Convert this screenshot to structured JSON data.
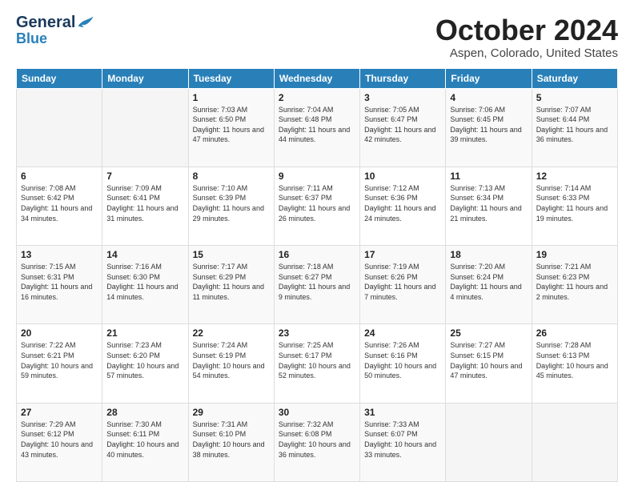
{
  "header": {
    "logo_general": "General",
    "logo_blue": "Blue",
    "title": "October 2024",
    "location": "Aspen, Colorado, United States"
  },
  "weekdays": [
    "Sunday",
    "Monday",
    "Tuesday",
    "Wednesday",
    "Thursday",
    "Friday",
    "Saturday"
  ],
  "weeks": [
    [
      {
        "day": "",
        "info": ""
      },
      {
        "day": "",
        "info": ""
      },
      {
        "day": "1",
        "info": "Sunrise: 7:03 AM\nSunset: 6:50 PM\nDaylight: 11 hours and 47 minutes."
      },
      {
        "day": "2",
        "info": "Sunrise: 7:04 AM\nSunset: 6:48 PM\nDaylight: 11 hours and 44 minutes."
      },
      {
        "day": "3",
        "info": "Sunrise: 7:05 AM\nSunset: 6:47 PM\nDaylight: 11 hours and 42 minutes."
      },
      {
        "day": "4",
        "info": "Sunrise: 7:06 AM\nSunset: 6:45 PM\nDaylight: 11 hours and 39 minutes."
      },
      {
        "day": "5",
        "info": "Sunrise: 7:07 AM\nSunset: 6:44 PM\nDaylight: 11 hours and 36 minutes."
      }
    ],
    [
      {
        "day": "6",
        "info": "Sunrise: 7:08 AM\nSunset: 6:42 PM\nDaylight: 11 hours and 34 minutes."
      },
      {
        "day": "7",
        "info": "Sunrise: 7:09 AM\nSunset: 6:41 PM\nDaylight: 11 hours and 31 minutes."
      },
      {
        "day": "8",
        "info": "Sunrise: 7:10 AM\nSunset: 6:39 PM\nDaylight: 11 hours and 29 minutes."
      },
      {
        "day": "9",
        "info": "Sunrise: 7:11 AM\nSunset: 6:37 PM\nDaylight: 11 hours and 26 minutes."
      },
      {
        "day": "10",
        "info": "Sunrise: 7:12 AM\nSunset: 6:36 PM\nDaylight: 11 hours and 24 minutes."
      },
      {
        "day": "11",
        "info": "Sunrise: 7:13 AM\nSunset: 6:34 PM\nDaylight: 11 hours and 21 minutes."
      },
      {
        "day": "12",
        "info": "Sunrise: 7:14 AM\nSunset: 6:33 PM\nDaylight: 11 hours and 19 minutes."
      }
    ],
    [
      {
        "day": "13",
        "info": "Sunrise: 7:15 AM\nSunset: 6:31 PM\nDaylight: 11 hours and 16 minutes."
      },
      {
        "day": "14",
        "info": "Sunrise: 7:16 AM\nSunset: 6:30 PM\nDaylight: 11 hours and 14 minutes."
      },
      {
        "day": "15",
        "info": "Sunrise: 7:17 AM\nSunset: 6:29 PM\nDaylight: 11 hours and 11 minutes."
      },
      {
        "day": "16",
        "info": "Sunrise: 7:18 AM\nSunset: 6:27 PM\nDaylight: 11 hours and 9 minutes."
      },
      {
        "day": "17",
        "info": "Sunrise: 7:19 AM\nSunset: 6:26 PM\nDaylight: 11 hours and 7 minutes."
      },
      {
        "day": "18",
        "info": "Sunrise: 7:20 AM\nSunset: 6:24 PM\nDaylight: 11 hours and 4 minutes."
      },
      {
        "day": "19",
        "info": "Sunrise: 7:21 AM\nSunset: 6:23 PM\nDaylight: 11 hours and 2 minutes."
      }
    ],
    [
      {
        "day": "20",
        "info": "Sunrise: 7:22 AM\nSunset: 6:21 PM\nDaylight: 10 hours and 59 minutes."
      },
      {
        "day": "21",
        "info": "Sunrise: 7:23 AM\nSunset: 6:20 PM\nDaylight: 10 hours and 57 minutes."
      },
      {
        "day": "22",
        "info": "Sunrise: 7:24 AM\nSunset: 6:19 PM\nDaylight: 10 hours and 54 minutes."
      },
      {
        "day": "23",
        "info": "Sunrise: 7:25 AM\nSunset: 6:17 PM\nDaylight: 10 hours and 52 minutes."
      },
      {
        "day": "24",
        "info": "Sunrise: 7:26 AM\nSunset: 6:16 PM\nDaylight: 10 hours and 50 minutes."
      },
      {
        "day": "25",
        "info": "Sunrise: 7:27 AM\nSunset: 6:15 PM\nDaylight: 10 hours and 47 minutes."
      },
      {
        "day": "26",
        "info": "Sunrise: 7:28 AM\nSunset: 6:13 PM\nDaylight: 10 hours and 45 minutes."
      }
    ],
    [
      {
        "day": "27",
        "info": "Sunrise: 7:29 AM\nSunset: 6:12 PM\nDaylight: 10 hours and 43 minutes."
      },
      {
        "day": "28",
        "info": "Sunrise: 7:30 AM\nSunset: 6:11 PM\nDaylight: 10 hours and 40 minutes."
      },
      {
        "day": "29",
        "info": "Sunrise: 7:31 AM\nSunset: 6:10 PM\nDaylight: 10 hours and 38 minutes."
      },
      {
        "day": "30",
        "info": "Sunrise: 7:32 AM\nSunset: 6:08 PM\nDaylight: 10 hours and 36 minutes."
      },
      {
        "day": "31",
        "info": "Sunrise: 7:33 AM\nSunset: 6:07 PM\nDaylight: 10 hours and 33 minutes."
      },
      {
        "day": "",
        "info": ""
      },
      {
        "day": "",
        "info": ""
      }
    ]
  ]
}
